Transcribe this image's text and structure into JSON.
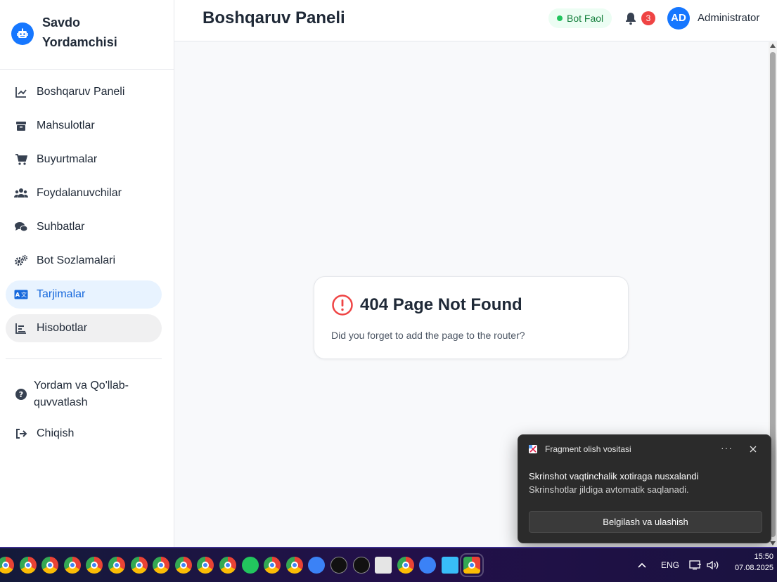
{
  "brand": {
    "name": "Savdo Yordamchisi"
  },
  "sidebar": {
    "items": [
      {
        "label": "Boshqaruv Paneli",
        "icon": "line-chart-icon"
      },
      {
        "label": "Mahsulotlar",
        "icon": "box-icon"
      },
      {
        "label": "Buyurtmalar",
        "icon": "cart-icon"
      },
      {
        "label": "Foydalanuvchilar",
        "icon": "users-icon"
      },
      {
        "label": "Suhbatlar",
        "icon": "chat-icon"
      },
      {
        "label": "Bot Sozlamalari",
        "icon": "gears-icon"
      },
      {
        "label": "Tarjimalar",
        "icon": "language-icon",
        "active": true
      },
      {
        "label": "Hisobotlar",
        "icon": "bar-chart-icon"
      }
    ],
    "help": {
      "label": "Yordam va Qo'llab-quvvatlash",
      "icon": "question-icon"
    },
    "logout": {
      "label": "Chiqish",
      "icon": "logout-icon"
    }
  },
  "header": {
    "title": "Boshqaruv Paneli",
    "bot_status": "Bot Faol",
    "notification_count": "3",
    "avatar_initials": "AD",
    "user_name": "Administrator"
  },
  "error_card": {
    "title": "404 Page Not Found",
    "description": "Did you forget to add the page to the router?"
  },
  "toast": {
    "app_name": "Fragment olish vositasi",
    "more": "···",
    "title": "Skrinshot vaqtinchalik xotiraga nusxalandi",
    "body": "Skrinshotlar jildiga avtomatik saqlanadi.",
    "button": "Belgilash va ulashish"
  },
  "taskbar": {
    "language": "ENG",
    "time": "15:50",
    "date": "07.08.2025"
  },
  "colors": {
    "accent": "#1677ff",
    "active_bg": "#e8f3ff",
    "active_text": "#1668dc",
    "status_green": "#22c55e",
    "error_red": "#ef4444"
  }
}
